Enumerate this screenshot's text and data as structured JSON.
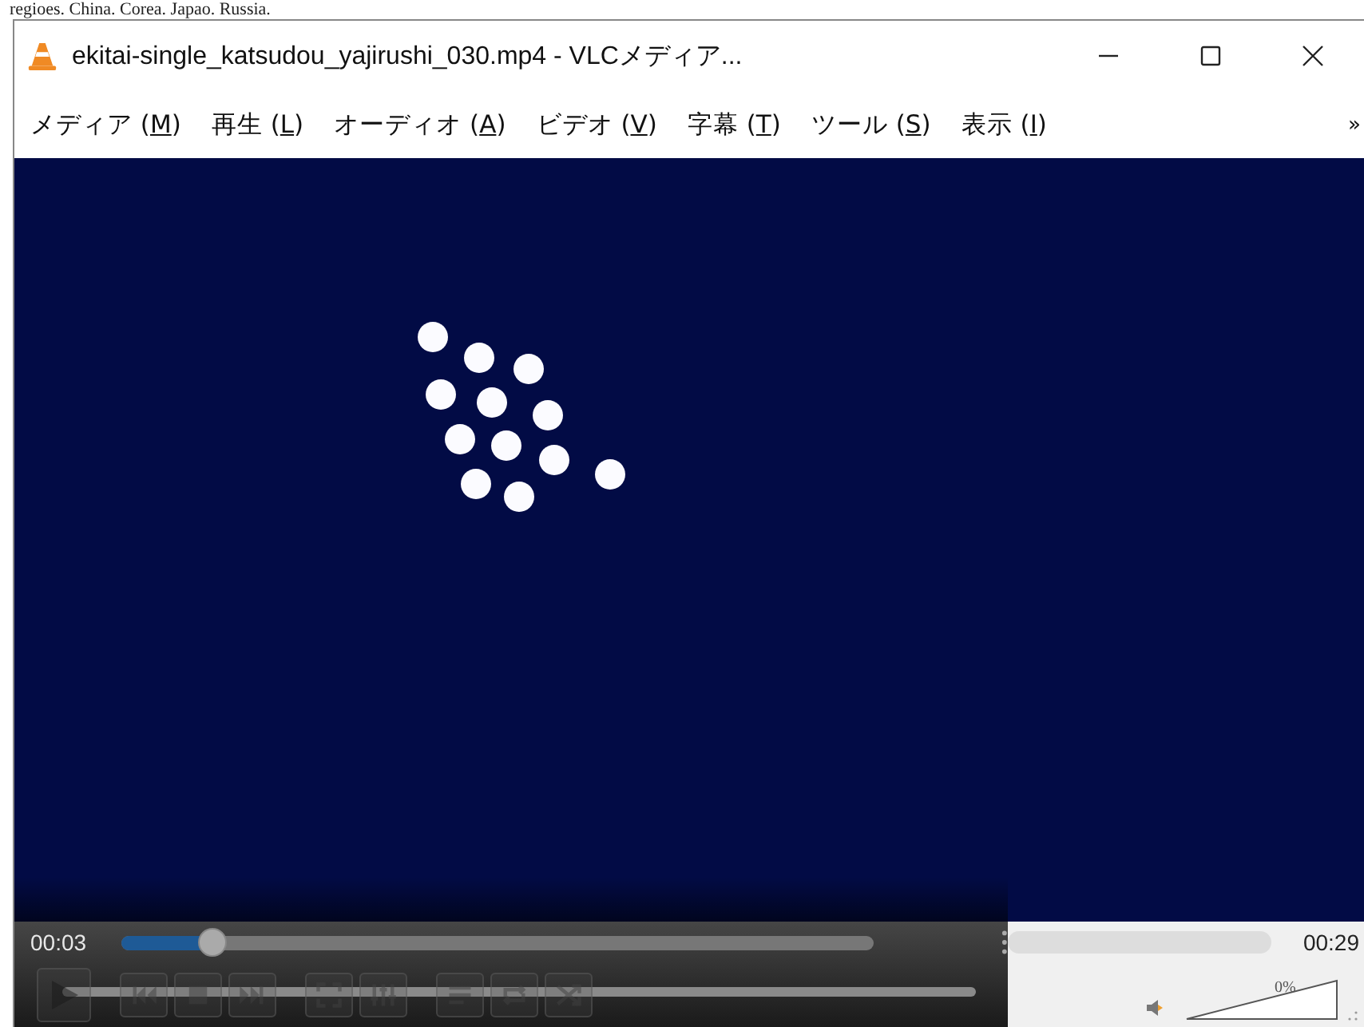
{
  "background_text": "regioes. China. Corea. Japao. Russia.",
  "window": {
    "title": "ekitai-single_katsudou_yajirushi_030.mp4 - VLCメディア..."
  },
  "menu": {
    "items": [
      {
        "label": "メディア (M)"
      },
      {
        "label": "再生 (L)"
      },
      {
        "label": "オーディオ (A)"
      },
      {
        "label": "ビデオ (V)"
      },
      {
        "label": "字幕 (T)"
      },
      {
        "label": "ツール (S)"
      },
      {
        "label": "表示 (I)"
      }
    ],
    "overflow": "»"
  },
  "player": {
    "elapsed": "00:03",
    "total": "00:29",
    "seek": {
      "level": 0.12
    },
    "volume": {
      "level": 0,
      "reading": "0%"
    }
  }
}
